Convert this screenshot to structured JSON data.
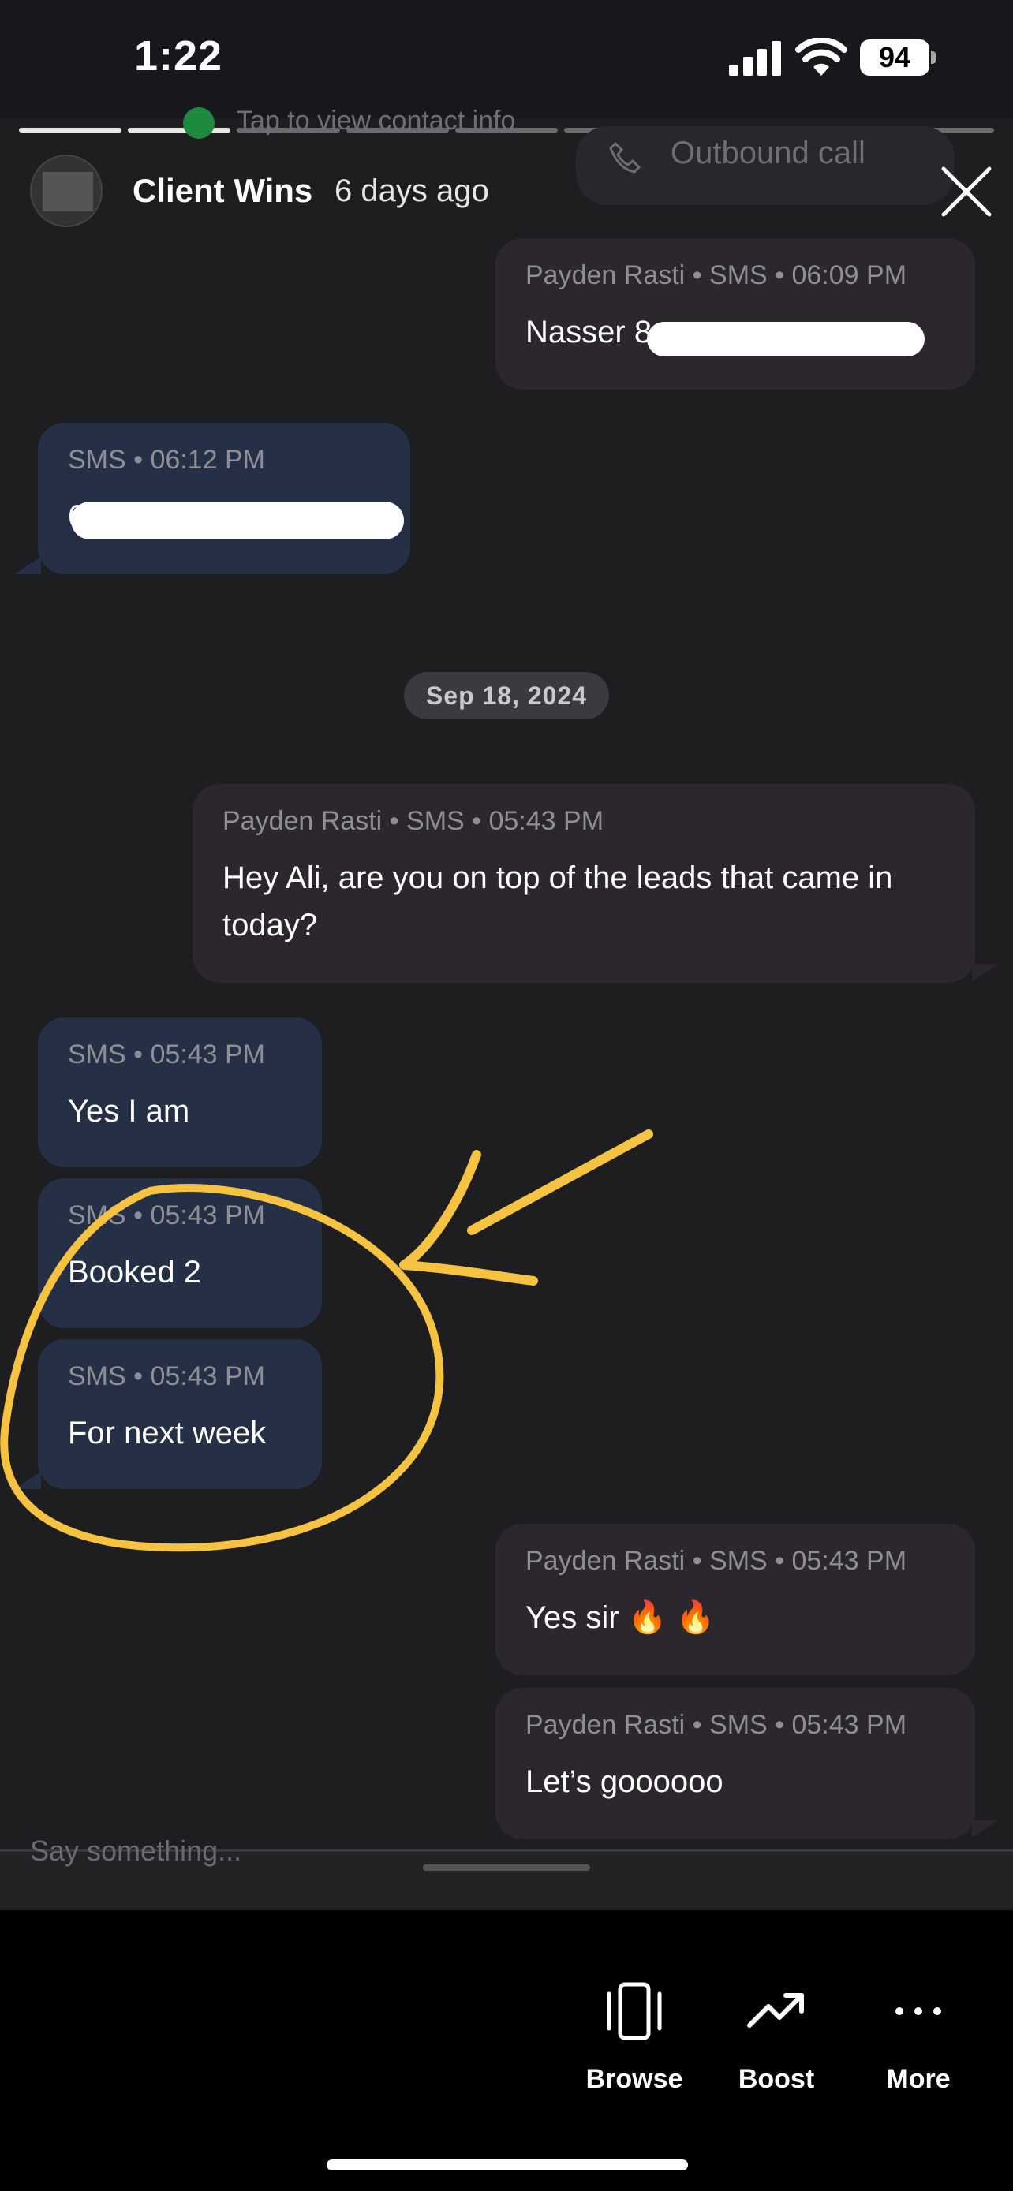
{
  "status_bar": {
    "time": "1:22",
    "battery_level": "94"
  },
  "story_header": {
    "contact_info_text": "Tap to view contact info",
    "outbound_label": "Outbound call",
    "title": "Client Wins",
    "timestamp": "6 days ago",
    "progress_segments_total": 9,
    "progress_segments_completed": 2
  },
  "messages": [
    {
      "direction": "outgoing",
      "meta": "Payden Rasti • SMS • 06:09 PM",
      "text": "Nasser 8",
      "redacted": true
    },
    {
      "direction": "incoming",
      "meta": "SMS • 06:12 PM",
      "text": "647",
      "redacted": true
    },
    {
      "direction": "outgoing",
      "meta": "Payden Rasti • SMS • 05:43 PM",
      "text": "Hey Ali, are you on top of the leads that came in today?"
    },
    {
      "direction": "incoming",
      "meta": "SMS • 05:43 PM",
      "text": "Yes I am"
    },
    {
      "direction": "incoming",
      "meta": "SMS • 05:43 PM",
      "text": "Booked 2"
    },
    {
      "direction": "incoming",
      "meta": "SMS • 05:43 PM",
      "text": "For next week"
    },
    {
      "direction": "outgoing",
      "meta": "Payden Rasti • SMS • 05:43 PM",
      "text": "Yes sir 🔥 🔥"
    },
    {
      "direction": "outgoing",
      "meta": "Payden Rasti • SMS • 05:43 PM",
      "text": "Let’s goooooo"
    }
  ],
  "date_divider": "Sep 18, 2024",
  "composer": {
    "placeholder": "Say something..."
  },
  "actions": [
    {
      "label": "Browse",
      "icon": "browse-icon"
    },
    {
      "label": "Boost",
      "icon": "trending-up-icon"
    },
    {
      "label": "More",
      "icon": "more-dots-icon"
    }
  ],
  "colors": {
    "background": "#1e1e21",
    "outgoing_bubble": "#2b272d",
    "incoming_bubble": "#253046",
    "annotation": "#f5c242"
  }
}
